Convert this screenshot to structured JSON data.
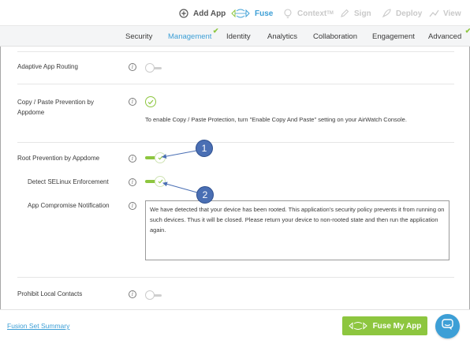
{
  "toolbar": {
    "add_app": "Add App",
    "fuse": "Fuse",
    "context": "Context",
    "context_tm": "TM",
    "sign": "Sign",
    "deploy": "Deploy",
    "view": "View"
  },
  "tabs": [
    {
      "label": "Security"
    },
    {
      "label": "Management"
    },
    {
      "label": "Identity"
    },
    {
      "label": "Analytics"
    },
    {
      "label": "Collaboration"
    },
    {
      "label": "Engagement"
    },
    {
      "label": "Advanced"
    }
  ],
  "settings": {
    "adaptive_routing": {
      "label": "Adaptive App Routing",
      "enabled": false
    },
    "copy_paste": {
      "label": "Copy / Paste Prevention by Appdome",
      "hint": "To enable Copy / Paste Protection, turn \"Enable Copy And Paste\" setting on your AirWatch Console."
    },
    "root_prevention": {
      "label": "Root Prevention by Appdome",
      "enabled": true
    },
    "selinux": {
      "label": "Detect SELinux Enforcement",
      "enabled": true
    },
    "compromise_notification": {
      "label": "App Compromise Notification",
      "value": "We have detected that your device has been rooted. This application's security policy prevents it from running on such devices. Thus it will be closed. Please return your device to non-rooted state and then run the application again."
    },
    "local_contacts": {
      "label": "Prohibit Local Contacts",
      "enabled": false
    }
  },
  "callouts": {
    "one": "1",
    "two": "2"
  },
  "footer": {
    "summary_link": "Fusion Set Summary",
    "fuse_button": "Fuse My App"
  },
  "colors": {
    "accent": "#3d9fd6",
    "green": "#8dc63f",
    "callout": "#4a6fb4"
  }
}
